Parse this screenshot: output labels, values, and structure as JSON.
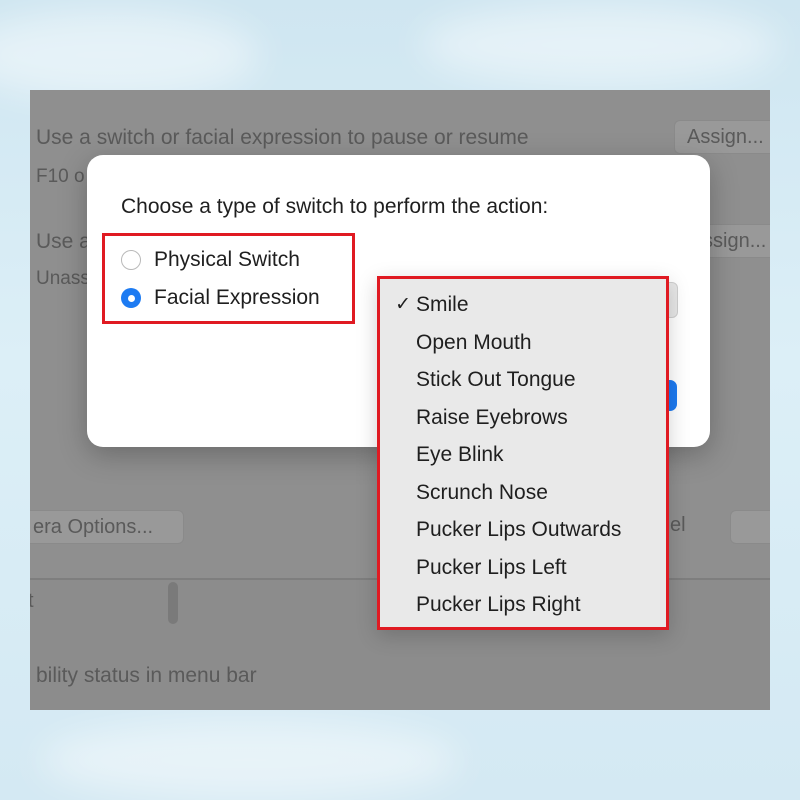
{
  "background_window": {
    "row1_label": "Use a switch or facial expression to pause or resume",
    "row1_sub": "F10 o",
    "row1_button": "Assign...",
    "row2_label": "Use a",
    "row2_sub": "Unass",
    "row2_button": "ssign...",
    "camera_button": "era Options...",
    "cancel_fragment": "el",
    "lower_fragment": "t",
    "status_label": "bility status in menu bar"
  },
  "dialog": {
    "prompt": "Choose a type of switch to perform the action:",
    "options": [
      {
        "label": "Physical Switch",
        "selected": false
      },
      {
        "label": "Facial Expression",
        "selected": true
      }
    ]
  },
  "menu": {
    "check_glyph": "✓",
    "items": [
      {
        "label": "Smile",
        "checked": true
      },
      {
        "label": "Open Mouth",
        "checked": false
      },
      {
        "label": "Stick Out Tongue",
        "checked": false
      },
      {
        "label": "Raise Eyebrows",
        "checked": false
      },
      {
        "label": "Eye Blink",
        "checked": false
      },
      {
        "label": "Scrunch Nose",
        "checked": false
      },
      {
        "label": "Pucker Lips Outwards",
        "checked": false
      },
      {
        "label": "Pucker Lips Left",
        "checked": false
      },
      {
        "label": "Pucker Lips Right",
        "checked": false
      }
    ]
  },
  "colors": {
    "highlight": "#e01a22",
    "accent": "#1d7bf2"
  }
}
